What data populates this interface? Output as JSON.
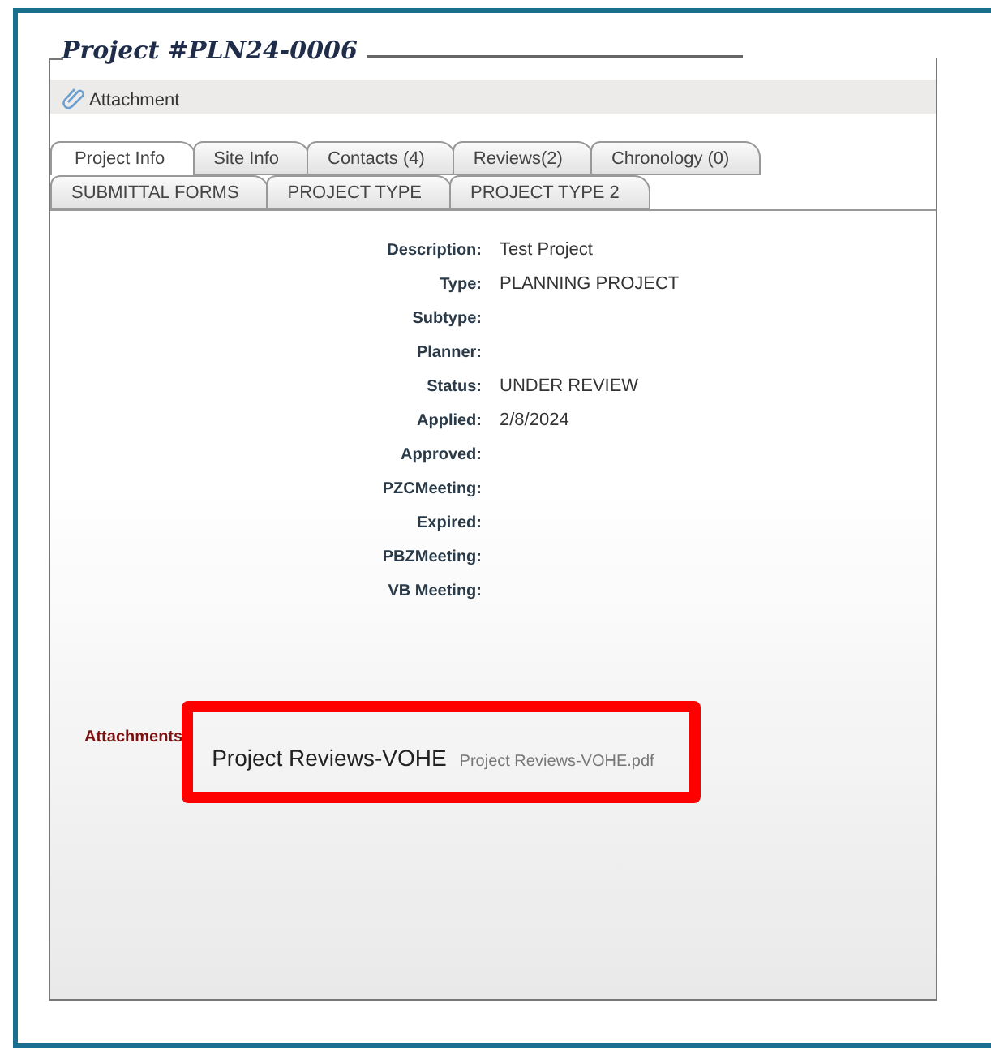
{
  "title": "Project #PLN24-0006",
  "toolbar": {
    "label": "Attachment"
  },
  "tab_rows": [
    [
      {
        "label": "Project Info",
        "selected": true
      },
      {
        "label": "Site Info",
        "selected": false
      },
      {
        "label": "Contacts (4)",
        "selected": false
      },
      {
        "label": "Reviews(2)",
        "selected": false
      },
      {
        "label": "Chronology (0)",
        "selected": false
      }
    ],
    [
      {
        "label": "SUBMITTAL FORMS",
        "selected": false
      },
      {
        "label": "PROJECT TYPE",
        "selected": false
      },
      {
        "label": "PROJECT TYPE 2",
        "selected": false
      }
    ]
  ],
  "fields": [
    {
      "label": "Description:",
      "value": "Test Project"
    },
    {
      "label": "Type:",
      "value": "PLANNING PROJECT"
    },
    {
      "label": "Subtype:"
    },
    {
      "label": "Planner:"
    },
    {
      "label": "Status:",
      "value": "UNDER REVIEW"
    },
    {
      "label": "Applied:",
      "value": "2/8/2024"
    },
    {
      "label": "Approved:"
    },
    {
      "label": "PZCMeeting:"
    },
    {
      "label": "Expired:"
    },
    {
      "label": "PBZMeeting:"
    },
    {
      "label": "VB Meeting:"
    }
  ],
  "attachments": {
    "label": "Attachments",
    "items": [
      {
        "name": "Project Reviews-VOHE",
        "file": "Project Reviews-VOHE.pdf"
      }
    ]
  }
}
